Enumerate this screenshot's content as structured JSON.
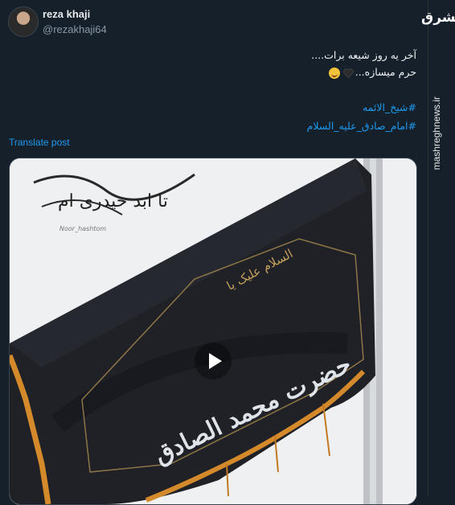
{
  "post": {
    "display_name": "reza khaji",
    "handle": "@rezakhaji64",
    "text_line1": "آخر یه روز شیعه برات....",
    "text_line2": "حرم میسازه...",
    "hashtags": [
      "#شیخ_الائمه",
      "#امام_صادق_علیه_السلام"
    ],
    "translate_label": "Translate post"
  },
  "media": {
    "overlay_line1": "تا ابد حیدری ام",
    "overlay_credit": "Noor_hashtom",
    "flag_small_text": "السلام علیک یا",
    "flag_main_text": "حضرت محمد الصادق",
    "flag_color": "#1f2127",
    "fringe_color": "#d48a2a",
    "play_icon": "play-icon"
  },
  "watermark": {
    "logo": "مشرق",
    "site": "mashreghnews.ir"
  },
  "colors": {
    "background": "#15202b",
    "link": "#1d9bf0"
  }
}
